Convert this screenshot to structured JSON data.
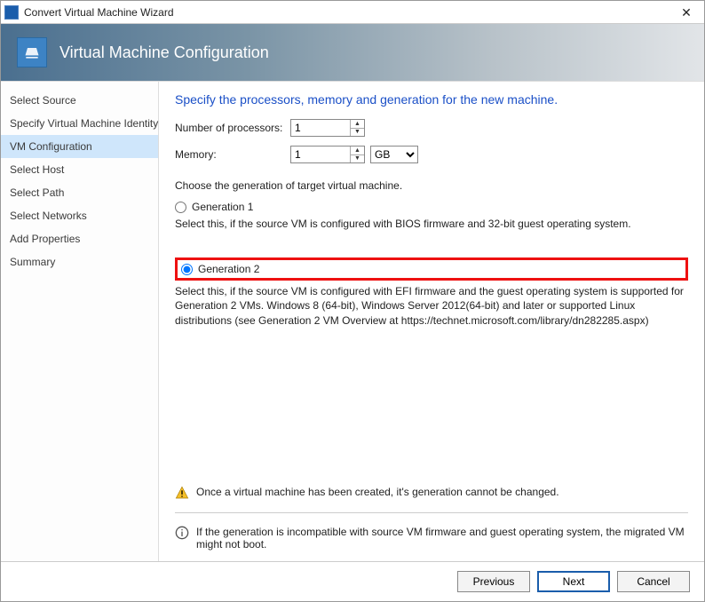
{
  "titlebar": {
    "title": "Convert Virtual Machine Wizard"
  },
  "banner": {
    "heading": "Virtual Machine Configuration"
  },
  "sidebar": {
    "steps": [
      {
        "label": "Select Source",
        "active": false
      },
      {
        "label": "Specify Virtual Machine Identity",
        "active": false
      },
      {
        "label": "VM Configuration",
        "active": true
      },
      {
        "label": "Select Host",
        "active": false
      },
      {
        "label": "Select Path",
        "active": false
      },
      {
        "label": "Select Networks",
        "active": false
      },
      {
        "label": "Add Properties",
        "active": false
      },
      {
        "label": "Summary",
        "active": false
      }
    ]
  },
  "main": {
    "heading": "Specify the processors, memory and generation for the new machine.",
    "processors_label": "Number of processors:",
    "processors_value": "1",
    "memory_label": "Memory:",
    "memory_value": "1",
    "memory_unit": "GB",
    "generation_intro": "Choose the generation of target virtual machine.",
    "gen1": {
      "label": "Generation 1",
      "desc": "Select this, if the source VM is configured with BIOS firmware and 32-bit guest operating system.",
      "checked": false
    },
    "gen2": {
      "label": "Generation 2",
      "desc": "Select this, if the source VM is configured with EFI firmware and the guest operating system is supported for Generation 2 VMs. Windows 8 (64-bit), Windows Server 2012(64-bit) and later or supported Linux distributions (see Generation 2 VM Overview at https://technet.microsoft.com/library/dn282285.aspx)",
      "checked": true
    },
    "warning": "Once a virtual machine has been created, it's generation cannot be changed.",
    "info": "If the generation is incompatible with source VM firmware and guest operating system, the migrated VM might not boot."
  },
  "footer": {
    "previous": "Previous",
    "next": "Next",
    "cancel": "Cancel"
  }
}
